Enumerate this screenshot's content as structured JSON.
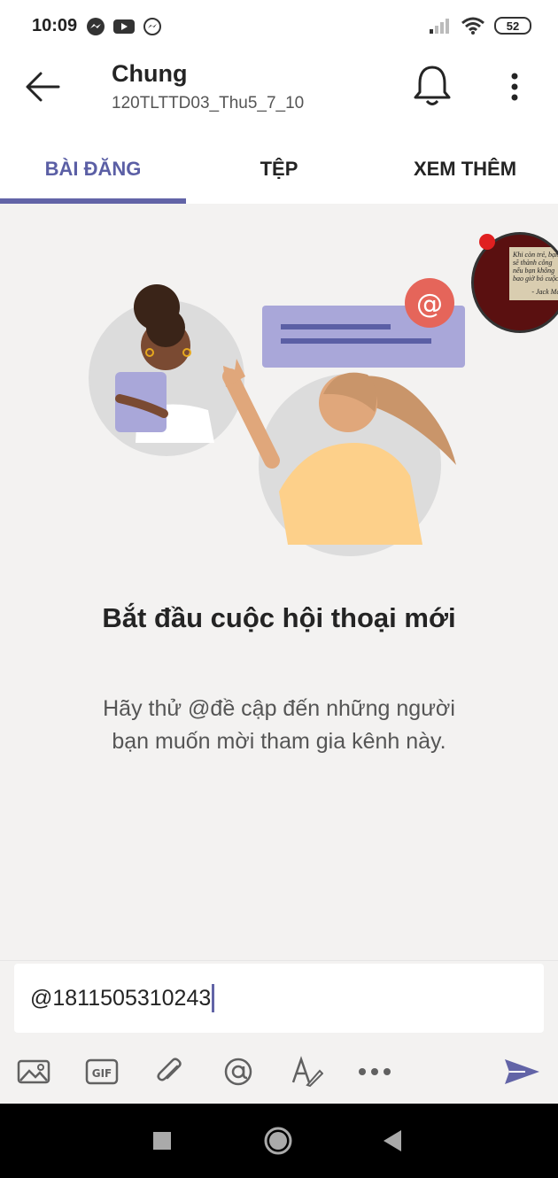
{
  "status_bar": {
    "time": "10:09",
    "battery": "52",
    "icons": [
      "messenger-icon",
      "youtube-icon",
      "messenger-icon",
      "signal-icon",
      "wifi-icon",
      "battery-icon"
    ]
  },
  "header": {
    "title": "Chung",
    "subtitle": "120TLTTD03_Thu5_7_10",
    "icons": [
      "back-arrow-icon",
      "bell-icon",
      "more-vertical-icon"
    ]
  },
  "tabs": [
    {
      "label": "BÀI ĐĂNG",
      "active": true
    },
    {
      "label": "TỆP",
      "active": false
    },
    {
      "label": "XEM THÊM",
      "active": false
    }
  ],
  "empty_state": {
    "heading": "Bắt đầu cuộc hội thoại mới",
    "line1": "Hãy thử @đề cập đến những người",
    "line2": "bạn muốn mời tham gia kênh này."
  },
  "chat_head": {
    "lines": [
      "Khi còn trẻ, bạn",
      "sẽ thành công",
      "nếu bạn không",
      "bao giờ bỏ cuộc"
    ],
    "author": "- Jack Ma -"
  },
  "composer": {
    "value": "@1811505310243",
    "tools": [
      "image-icon",
      "gif-icon",
      "attach-icon",
      "mention-icon",
      "format-icon",
      "more-horizontal-icon",
      "send-icon"
    ]
  },
  "colors": {
    "accent": "#6264a7",
    "background": "#f3f2f1",
    "text": "#242424"
  }
}
